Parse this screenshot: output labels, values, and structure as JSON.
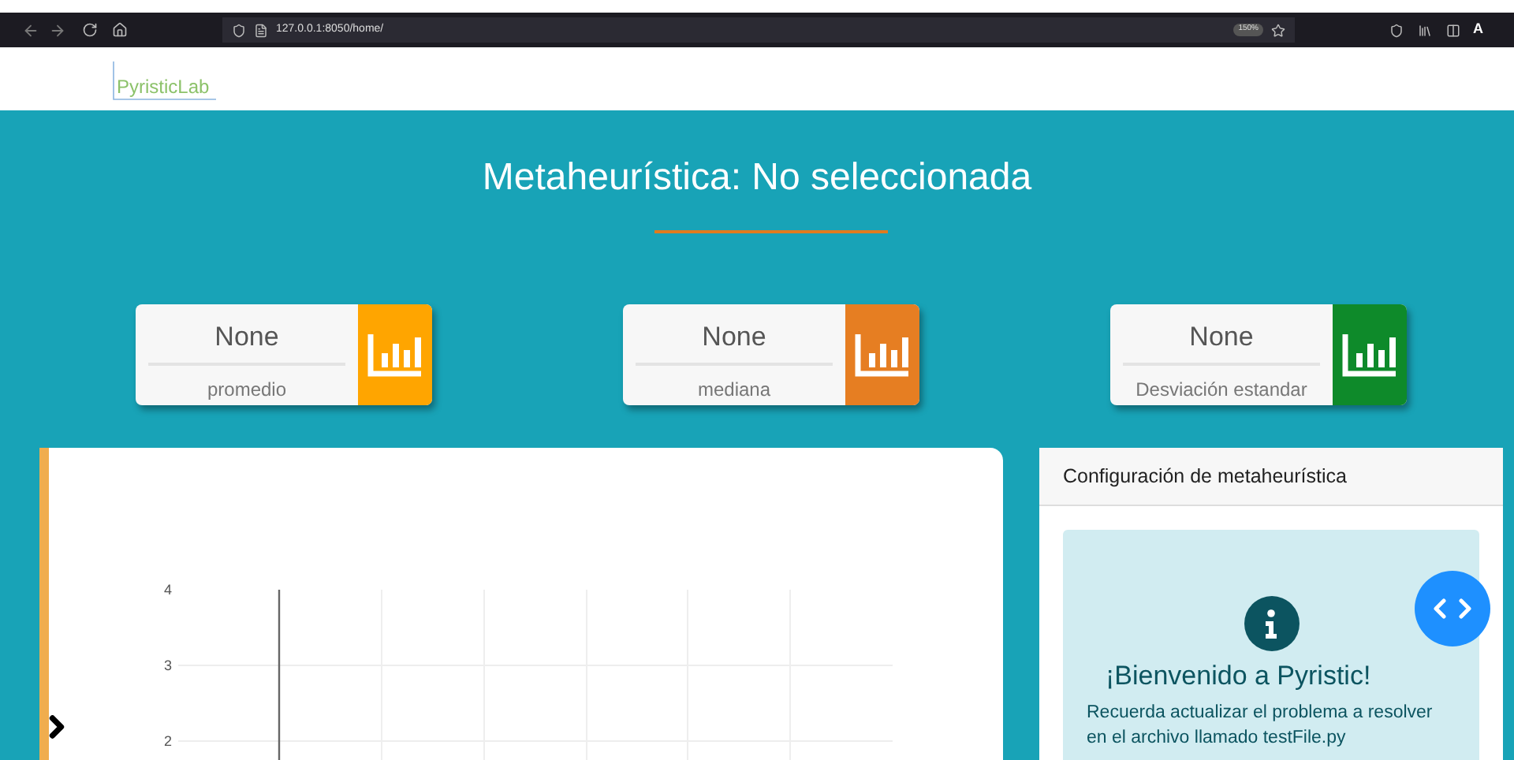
{
  "browser": {
    "url": "127.0.0.1:8050/home/",
    "zoom": "150%",
    "profile": "A"
  },
  "logo": {
    "text": "PyristicLab"
  },
  "title": "Metaheurística: No seleccionada",
  "stats": [
    {
      "value": "None",
      "label": "promedio",
      "color": "#ffa500"
    },
    {
      "value": "None",
      "label": "mediana",
      "color": "#e67e22"
    },
    {
      "value": "None",
      "label": "Desviación estandar",
      "color": "#0e8a2a"
    }
  ],
  "chart_panel": {
    "axis_labels": [
      "4",
      "3",
      "2"
    ]
  },
  "config_panel": {
    "header": "Configuración de metaheurística",
    "welcome_title": "¡Bienvenido a Pyristic!",
    "welcome_text": "Recuerda actualizar el problema a resolver en el archivo llamado testFile.py"
  }
}
